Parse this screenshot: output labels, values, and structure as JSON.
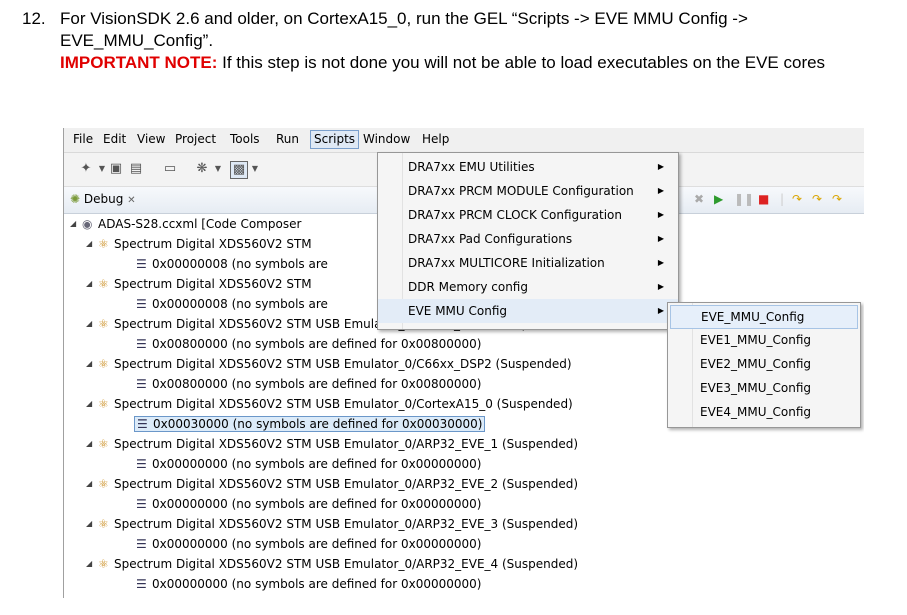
{
  "instruction": {
    "number": "12.",
    "text": "For VisionSDK 2.6 and older, on CortexA15_0, run the GEL “Scripts -> EVE MMU Config -> EVE_MMU_Config”.",
    "note_label": "IMPORTANT NOTE:",
    "note_text": " If this step is not done you will not be able to load executables on the EVE cores"
  },
  "menubar": [
    "File",
    "Edit",
    "View",
    "Project",
    "Tools",
    "Run",
    "Scripts",
    "Window",
    "Help"
  ],
  "debug_tab": {
    "label": "Debug",
    "close": "✕"
  },
  "tree": {
    "root": "ADAS-S28.ccxml [Code Composer",
    "rows": [
      {
        "device": "Spectrum Digital XDS560V2 STM",
        "addr": "0x00000008  (no symbols are"
      },
      {
        "device": "Spectrum Digital XDS560V2 STM",
        "addr": "0x00000008  (no symbols are"
      },
      {
        "device": "Spectrum Digital XDS560V2 STM USB Emulator_0/C66xx_DSP1 (Suspended)",
        "addr": "0x00800000  (no symbols are defined for 0x00800000)"
      },
      {
        "device": "Spectrum Digital XDS560V2 STM USB Emulator_0/C66xx_DSP2 (Suspended)",
        "addr": "0x00800000  (no symbols are defined for 0x00800000)"
      },
      {
        "device": "Spectrum Digital XDS560V2 STM USB Emulator_0/CortexA15_0 (Suspended)",
        "addr": "0x00030000  (no symbols are defined for 0x00030000)"
      },
      {
        "device": "Spectrum Digital XDS560V2 STM USB Emulator_0/ARP32_EVE_1 (Suspended)",
        "addr": "0x00000000  (no symbols are defined for 0x00000000)"
      },
      {
        "device": "Spectrum Digital XDS560V2 STM USB Emulator_0/ARP32_EVE_2 (Suspended)",
        "addr": "0x00000000  (no symbols are defined for 0x00000000)"
      },
      {
        "device": "Spectrum Digital XDS560V2 STM USB Emulator_0/ARP32_EVE_3 (Suspended)",
        "addr": "0x00000000  (no symbols are defined for 0x00000000)"
      },
      {
        "device": "Spectrum Digital XDS560V2 STM USB Emulator_0/ARP32_EVE_4 (Suspended)",
        "addr": "0x00000000  (no symbols are defined for 0x00000000)"
      }
    ]
  },
  "scripts_menu": [
    "DRA7xx EMU Utilities",
    "DRA7xx PRCM MODULE Configuration",
    "DRA7xx PRCM CLOCK Configuration",
    "DRA7xx Pad Configurations",
    "DRA7xx MULTICORE Initialization",
    "DDR Memory config",
    "EVE MMU Config"
  ],
  "eve_submenu": [
    "EVE_MMU_Config",
    "EVE1_MMU_Config",
    "EVE2_MMU_Config",
    "EVE3_MMU_Config",
    "EVE4_MMU_Config"
  ]
}
